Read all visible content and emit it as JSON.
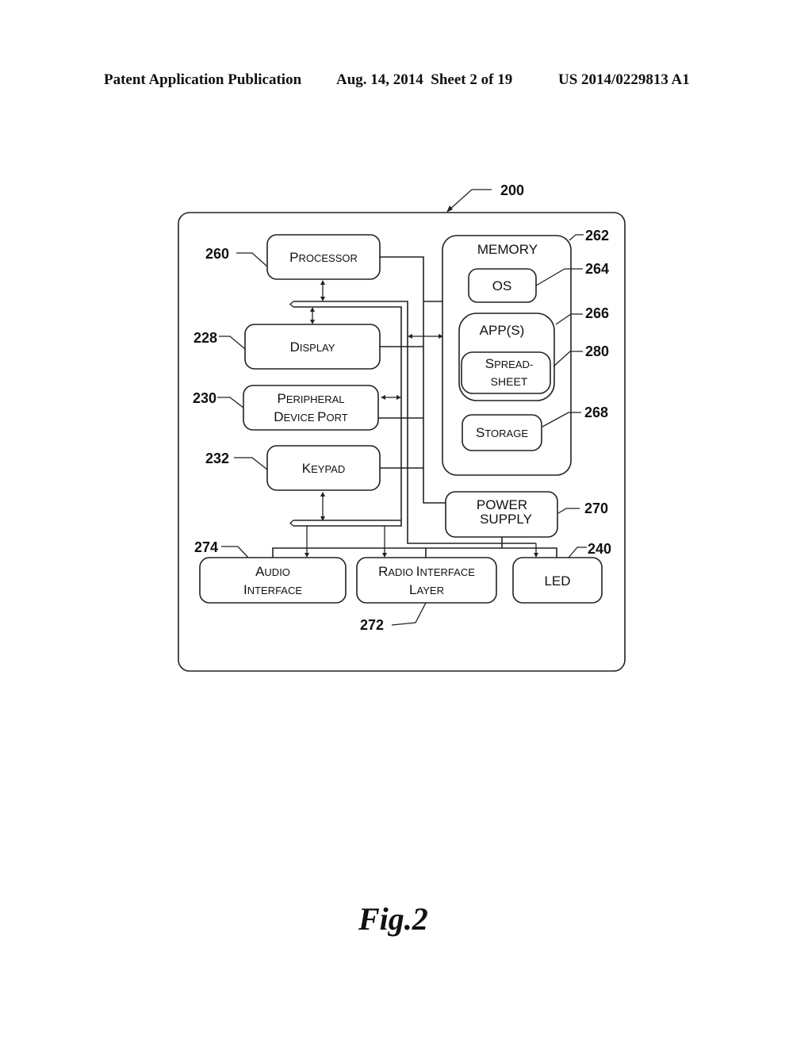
{
  "header": {
    "publication": "Patent Application Publication",
    "date_sheet": "Aug. 14, 2014  Sheet 2 of 19",
    "number": "US 2014/0229813 A1"
  },
  "diagram": {
    "device_ref": "200",
    "blocks": {
      "processor": {
        "ref": "260",
        "label_cap": "P",
        "label_rest": "ROCESSOR"
      },
      "display": {
        "ref": "228",
        "label_cap": "D",
        "label_rest": "ISPLAY"
      },
      "peripheral": {
        "ref": "230",
        "line1_cap": "P",
        "line1_rest": "ERIPHERAL",
        "line2_cap1": "D",
        "line2_rest1": "EVICE ",
        "line2_cap2": "P",
        "line2_rest2": "ORT"
      },
      "keypad": {
        "ref": "232",
        "label_cap": "K",
        "label_rest": "EYPAD"
      },
      "memory": {
        "ref": "262",
        "label": "MEMORY"
      },
      "os": {
        "ref": "264",
        "label": "OS"
      },
      "apps": {
        "ref": "266",
        "label": "APP(S)"
      },
      "spreadsheet": {
        "ref": "280",
        "line1_cap": "S",
        "line1_rest": "PREAD-",
        "line2": "SHEET"
      },
      "storage": {
        "ref": "268",
        "label_cap": "S",
        "label_rest": "TORAGE"
      },
      "power_supply": {
        "ref": "270",
        "line1": "POWER",
        "line2": "SUPPLY"
      },
      "audio": {
        "ref": "274",
        "line1_cap": "A",
        "line1_rest": "UDIO",
        "line2_cap": "I",
        "line2_rest": "NTERFACE"
      },
      "radio": {
        "ref": "272",
        "line1_cap1": "R",
        "line1_rest1": "ADIO ",
        "line1_cap2": "I",
        "line1_rest2": "NTERFACE",
        "line2_cap": "L",
        "line2_rest": "AYER"
      },
      "led": {
        "ref": "240",
        "label": "LED"
      }
    }
  },
  "figure_label": "Fig.2"
}
